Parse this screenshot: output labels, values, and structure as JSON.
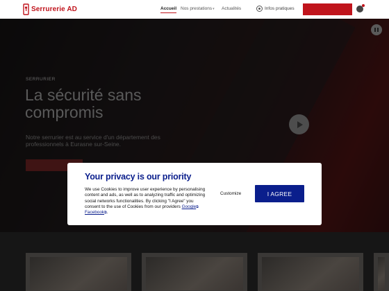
{
  "header": {
    "logo_text": "Serrurerie AD",
    "nav": [
      {
        "label": "Accueil",
        "active": true
      },
      {
        "label": "Nos prestations",
        "active": false
      },
      {
        "label": "Actualités",
        "active": false
      }
    ],
    "infos_label": "Infos pratiques",
    "cta_label": "",
    "brand_color": "#c0141c"
  },
  "hero": {
    "eyebrow": "SERRURIER",
    "title": "La sécurité sans compromis",
    "text": "Notre serrurier est au service d'un département des professionnels à Eurasne sur-Seine.",
    "button_label": ""
  },
  "cookie": {
    "title": "Your privacy is our priority",
    "body_text": "We use Cookies to improve user experience by personalising content and ads, as well as to analyzing traffic and optimizing social networks functionalities. By clicking \"I Agree\" you consent to the use of Cookies from our providers",
    "link_google": "Google",
    "link_and": " ",
    "link_facebook": "Facebook",
    "end": ".",
    "customize_label": "Customize",
    "agree_label": "I AGREE",
    "accent_color": "#0a1e8c"
  },
  "icons": {
    "info": "info-icon",
    "user": "user-icon",
    "play": "play-icon",
    "pause": "pause-icon",
    "external": "external-link-icon"
  }
}
